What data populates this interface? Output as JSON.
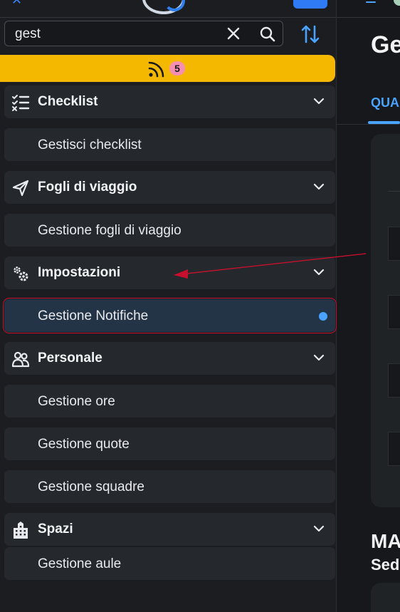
{
  "search": {
    "value": "gest"
  },
  "notifications": {
    "count": "5"
  },
  "menu": {
    "checklist": {
      "label": "Checklist",
      "items": [
        "Gestisci checklist"
      ]
    },
    "fogli": {
      "label": "Fogli di viaggio",
      "items": [
        "Gestione fogli di viaggio"
      ]
    },
    "impostazioni": {
      "label": "Impostazioni",
      "items": [
        "Gestione Notifiche"
      ]
    },
    "personale": {
      "label": "Personale",
      "items": [
        "Gestione ore",
        "Gestione quote",
        "Gestione squadre"
      ]
    },
    "spazi": {
      "label": "Spazi",
      "items": [
        "Gestione aule"
      ]
    }
  },
  "main": {
    "title": "Ge",
    "tab": "QUA",
    "section_title": "MA",
    "section_sub": "Sed"
  },
  "colors": {
    "accent": "#4aa3ff",
    "notification_bar": "#f5b800",
    "annotation": "#c8102e"
  },
  "icons": [
    "close-icon",
    "search-icon",
    "sort-icon",
    "rss-icon",
    "checklist-icon",
    "paper-plane-icon",
    "gears-icon",
    "people-icon",
    "building-icon",
    "chevron-down-icon"
  ]
}
